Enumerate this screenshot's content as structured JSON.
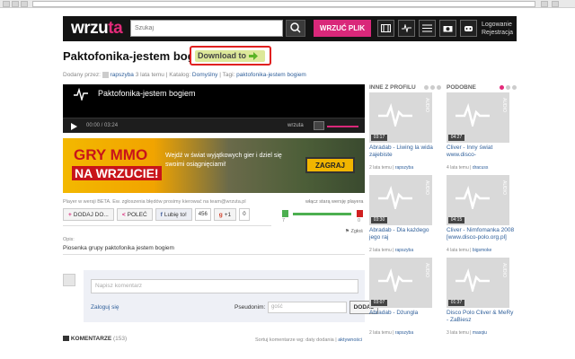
{
  "header": {
    "logo_main": "wrzu",
    "logo_accent": "ta",
    "search_placeholder": "Szukaj",
    "upload_label": "WRZUĆ PLIK",
    "login_label": "Logowanie",
    "register_label": "Rejestracja"
  },
  "page": {
    "title": "Paktofonika-jestem bogiem",
    "download_label": "Download to",
    "added_by_label": "Dodany przez:",
    "author": "rapszyba",
    "added_time": "3 lata temu",
    "catalog_label": "Katalog:",
    "catalog": "Domyślny",
    "tags_label": "Tagi:",
    "tags": "paktofonika-jestem bogiem"
  },
  "player": {
    "title": "Paktofonika-jestem bogiem",
    "time": "00:00 / 03:24",
    "brand": "wrzuta"
  },
  "banner": {
    "line1": "GRY MMO",
    "line2": "NA WRZUCIE!",
    "text": "Wejdź w świat wyjątkowych gier i dziel się swoimi osiągnięciami!",
    "cta": "ZAGRAJ"
  },
  "notices": {
    "beta": "Player w wersji BETA. Ew. zgłoszenia błędów prosimy kierować na team@wrzuta.pl",
    "old_player": "włącz starą wersję playera"
  },
  "actions": {
    "add_label": "DODAJ DO...",
    "recommend_label": "POLEĆ",
    "like_label": "Lubię to!",
    "like_count": "456",
    "gplus_label": "+1",
    "gplus_count": "0",
    "report_label": "Zgłoś"
  },
  "rating": {
    "up": "7",
    "down": "0",
    "fraction": 1.0
  },
  "description": {
    "label": "Opis:",
    "text": "Piosenka grupy paktofonika jestem bogiem"
  },
  "comment_form": {
    "placeholder": "Napisz komentarz",
    "login_link": "Zaloguj się",
    "pseudonim_label": "Pseudonim:",
    "pseudonim_placeholder": "gość",
    "submit_label": "DODAJ"
  },
  "comments": {
    "heading": "KOMENTARZE",
    "count": "(153)",
    "sort_label": "Sortuj komentarze wg: daty dodania |",
    "sort_active": "aktywności"
  },
  "sidebar_left": {
    "heading": "INNE Z PROFILU",
    "items": [
      {
        "duration": "03:17",
        "title": "Abradab - Liwing la wida zajebiste",
        "age": "2 lata temu",
        "user": "rapszyba"
      },
      {
        "duration": "03:30",
        "title": "Abradab - Dla każdego jego raj",
        "age": "2 lata temu",
        "user": "rapszyba"
      },
      {
        "duration": "03:07",
        "title": "Abradab - Dżungla",
        "age": "2 lata temu",
        "user": "rapszyba"
      }
    ]
  },
  "sidebar_right": {
    "heading": "PODOBNE",
    "items": [
      {
        "duration": "04:27",
        "title": "Cliver - Inny świat www.disco-",
        "age": "4 lata temu",
        "user": "dracuss"
      },
      {
        "duration": "04:15",
        "title": "Cliver - Nimfomanka 2008 [www.disco-polo.org.pl]",
        "age": "4 lata temu",
        "user": "bigsmoke"
      },
      {
        "duration": "01:37",
        "title": "Disco Polo Cliver & MeRy - ZaBiesz",
        "age": "3 lata temu",
        "user": "masqiu"
      }
    ]
  },
  "thumb_tag": "AUDIO",
  "colors": {
    "accent": "#e42a7a",
    "header_bg": "#141414",
    "link": "#2f5f9a"
  }
}
